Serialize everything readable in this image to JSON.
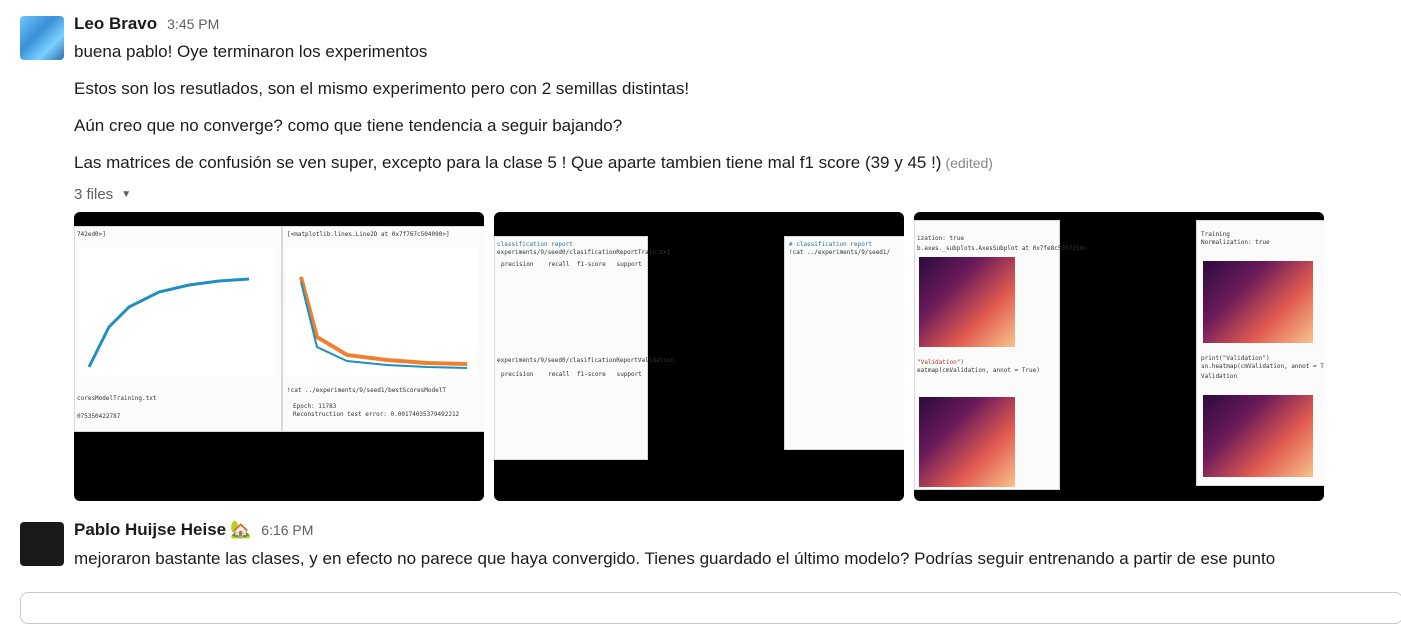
{
  "messages": [
    {
      "author": "Leo Bravo",
      "time": "3:45 PM",
      "lines": [
        "buena pablo! Oye terminaron los experimentos",
        "Estos son los resutlados, son el mismo experimento pero con 2 semillas distintas!",
        "Aún creo que no converge? como que tiene tendencia a seguir bajando?",
        "Las matrices de confusión se ven super, excepto para la clase 5 ! Que aparte tambien tiene mal f1 score (39 y 45 !)"
      ],
      "edited_label": "(edited)",
      "files_label": "3 files",
      "attachments": [
        {
          "name": "training-curves",
          "texts": [
            "742ed0>]",
            "[<matplotlib.lines.Line2D at 0x7f767c504090>]",
            "coresModelTraining.txt",
            "075350422787",
            "Epoch: 11783",
            "Reconstruction test error: 0.00174035379492212",
            "!cat ../experiments/9/seed1/bestScoresModelT",
            "train",
            "validation",
            "N° epoch",
            "Loss",
            "f1 score"
          ]
        },
        {
          "name": "classification-reports",
          "texts": [
            "classification report",
            "experiments/9/seed0/clasificationReportTrain.txt",
            "precision    recall  f1-score   support",
            "experiments/9/seed0/clasificationReportValidation",
            "# classification report",
            "!cat ../experiments/9/seed1/"
          ]
        },
        {
          "name": "confusion-matrices",
          "texts": [
            "ization: true",
            "b.axes._subplots.AxesSubplot at 0x7fe8c535f250>",
            "\"Validation\")",
            "eatmap(cmValidation, annot = True)",
            "Training",
            "Normalization: true",
            "print(\"Validation\")",
            "sn.heatmap(cmValidation, annot = T",
            "Validation"
          ]
        }
      ]
    },
    {
      "author": "Pablo Huijse Heise",
      "status_emoji": "🏡",
      "time": "6:16 PM",
      "lines": [
        "mejoraron bastante las clases, y en efecto no parece que haya convergido. Tienes guardado el último modelo? Podrías seguir entrenando a partir de ese punto"
      ]
    }
  ]
}
